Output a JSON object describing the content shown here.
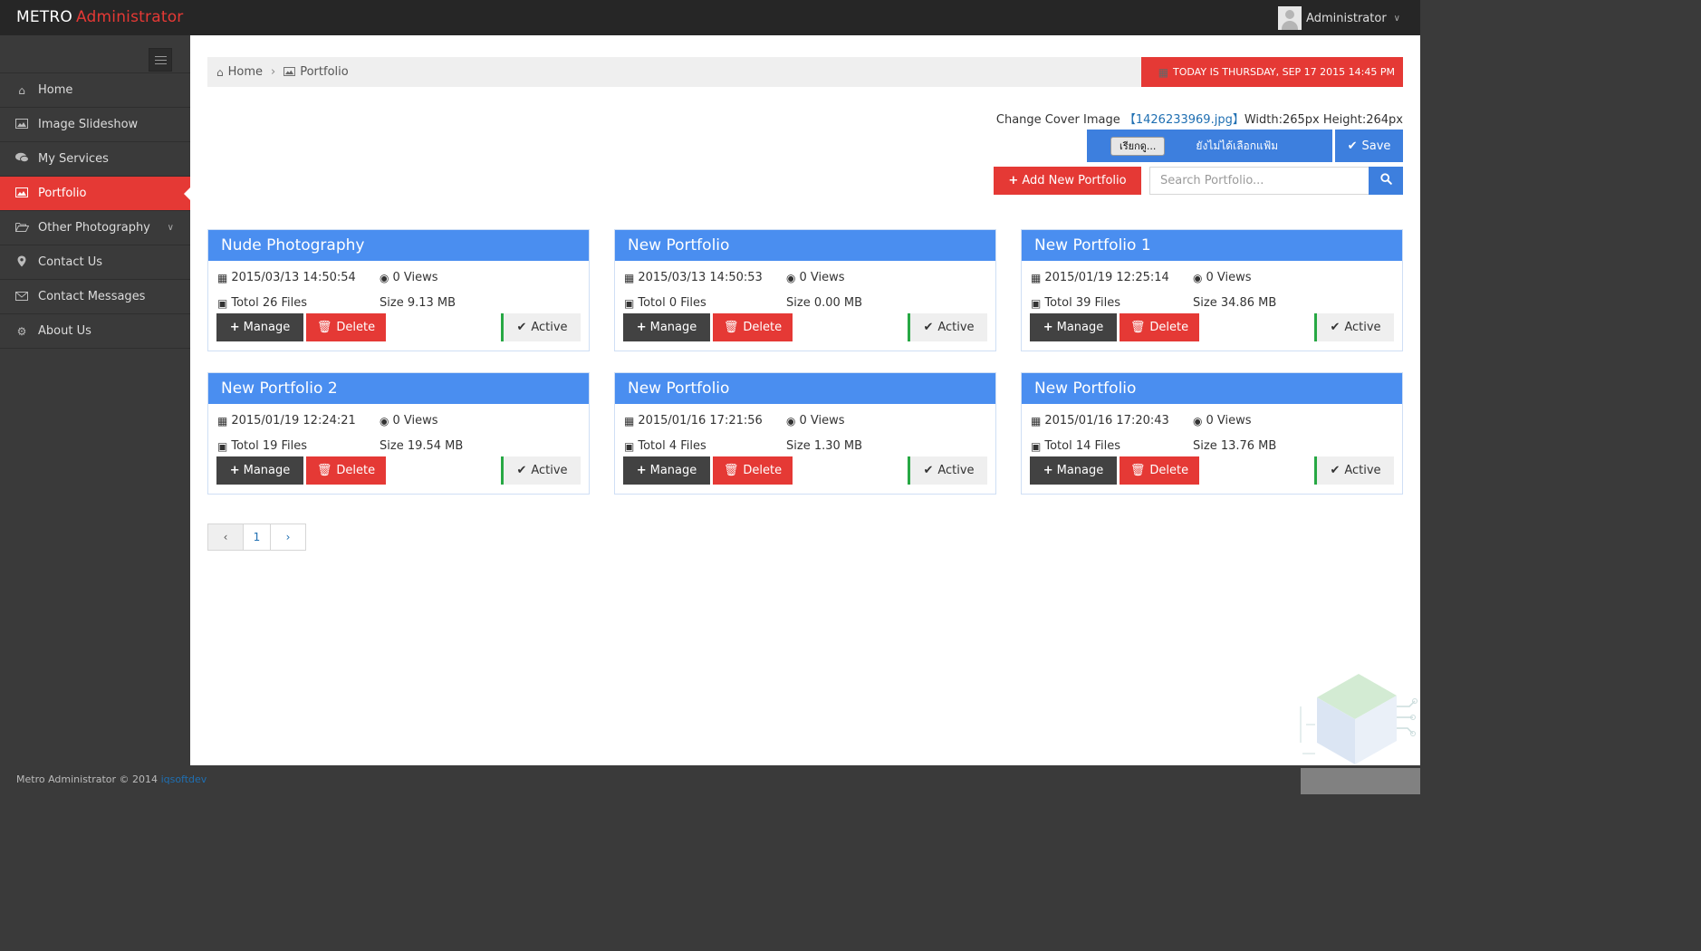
{
  "header": {
    "brand_main": "METRO",
    "brand_sub": "Administrator",
    "user_name": "Administrator"
  },
  "sidebar": {
    "items": [
      {
        "label": "Home",
        "icon": "home-icon"
      },
      {
        "label": "Image Slideshow",
        "icon": "image-icon"
      },
      {
        "label": "My Services",
        "icon": "comments-icon"
      },
      {
        "label": "Portfolio",
        "icon": "picture-icon",
        "active": true
      },
      {
        "label": "Other Photography",
        "icon": "folder-open-icon",
        "has_submenu": true
      },
      {
        "label": "Contact Us",
        "icon": "map-marker-icon"
      },
      {
        "label": "Contact Messages",
        "icon": "envelope-icon"
      },
      {
        "label": "About Us",
        "icon": "cogs-icon"
      }
    ]
  },
  "breadcrumb": {
    "home": "Home",
    "current": "Portfolio",
    "date_text": "TODAY IS THURSDAY, SEP 17 2015 14:45 PM"
  },
  "cover": {
    "label": "Change Cover Image",
    "bracket_open": "【",
    "file_name": "1426233969.jpg",
    "bracket_close": "】",
    "dimensions": "Width:265px Height:264px",
    "browse_label": "เรียกดู...",
    "no_file_text": "ยังไม่ได้เลือกแฟ้ม",
    "save_label": "Save"
  },
  "toolbar": {
    "add_label": "Add New Portfolio",
    "search_placeholder": "Search Portfolio..."
  },
  "cards": [
    {
      "title": "Nude Photography",
      "date": "2015/03/13 14:50:54",
      "views": "0 Views",
      "files": "Totol 26 Files",
      "size": "Size 9.13 MB",
      "manage": "Manage",
      "delete": "Delete",
      "status": "Active"
    },
    {
      "title": "New Portfolio",
      "date": "2015/03/13 14:50:53",
      "views": "0 Views",
      "files": "Totol 0 Files",
      "size": "Size 0.00 MB",
      "manage": "Manage",
      "delete": "Delete",
      "status": "Active"
    },
    {
      "title": "New Portfolio 1",
      "date": "2015/01/19 12:25:14",
      "views": "0 Views",
      "files": "Totol 39 Files",
      "size": "Size 34.86 MB",
      "manage": "Manage",
      "delete": "Delete",
      "status": "Active"
    },
    {
      "title": "New Portfolio 2",
      "date": "2015/01/19 12:24:21",
      "views": "0 Views",
      "files": "Totol 19 Files",
      "size": "Size 19.54 MB",
      "manage": "Manage",
      "delete": "Delete",
      "status": "Active"
    },
    {
      "title": "New Portfolio",
      "date": "2015/01/16 17:21:56",
      "views": "0 Views",
      "files": "Totol 4 Files",
      "size": "Size 1.30 MB",
      "manage": "Manage",
      "delete": "Delete",
      "status": "Active"
    },
    {
      "title": "New Portfolio",
      "date": "2015/01/16 17:20:43",
      "views": "0 Views",
      "files": "Totol 14 Files",
      "size": "Size 13.76 MB",
      "manage": "Manage",
      "delete": "Delete",
      "status": "Active"
    }
  ],
  "pagination": {
    "prev": "‹",
    "current": "1",
    "next": "›"
  },
  "footer": {
    "text": "Metro Administrator © 2014",
    "link": "iqsoftdev"
  },
  "colors": {
    "accent_red": "#e53935",
    "accent_blue": "#4a8ef0",
    "sidebar_bg": "#3a3a3a",
    "topbar_bg": "#262626",
    "active_green": "#27a844"
  }
}
